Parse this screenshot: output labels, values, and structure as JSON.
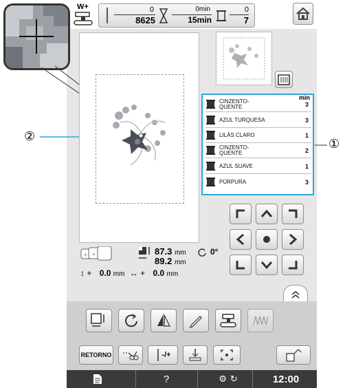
{
  "top": {
    "presser_label": "W+",
    "stitch_current": "0",
    "stitch_total": "8625",
    "time_current": "0min",
    "time_total": "15min",
    "color_current": "0",
    "color_total": "7"
  },
  "threads": [
    {
      "name_l1": "CINZENTO-",
      "name_l2": "QUENTE",
      "minutes": "3"
    },
    {
      "name_l1": "AZUL TURQUESA",
      "name_l2": "",
      "minutes": "3"
    },
    {
      "name_l1": "LILÁS CLARO",
      "name_l2": "",
      "minutes": "1"
    },
    {
      "name_l1": "CINZENTO-",
      "name_l2": "QUENTE",
      "minutes": "2"
    },
    {
      "name_l1": "AZUL SUAVE",
      "name_l2": "",
      "minutes": "1"
    },
    {
      "name_l1": "PÚRPURA",
      "name_l2": "",
      "minutes": "3"
    }
  ],
  "thread_min_header": "min",
  "measure": {
    "height": "87.3",
    "width": "89.2",
    "unit": "mm",
    "angle": "0°",
    "offset_v": "0.0",
    "offset_h": "0.0",
    "plus": "+"
  },
  "callouts": {
    "one": "①",
    "two": "②"
  },
  "bottom": {
    "retorno": "RETORNO",
    "minus_plus": "-/+",
    "help": "?",
    "clock": "12:00"
  },
  "colors": {
    "highlight": "#2aa7e0",
    "footer": "#3a3a3a"
  },
  "icons": [
    "home-icon",
    "machine-icon",
    "arrow-up-left",
    "arrow-up",
    "arrow-up-right",
    "arrow-left",
    "center-dot",
    "arrow-right",
    "arrow-down-left",
    "arrow-down",
    "arrow-down-right",
    "collapse-icon",
    "size-icon",
    "rotate-icon",
    "mirror-icon",
    "edit-icon",
    "sewing-icon",
    "density-icon",
    "jump-trim-icon",
    "thread-cut-icon",
    "needle-minus-plus-icon",
    "needle-position-icon",
    "trial-icon",
    "next-icon",
    "document-icon",
    "settings-icon"
  ]
}
